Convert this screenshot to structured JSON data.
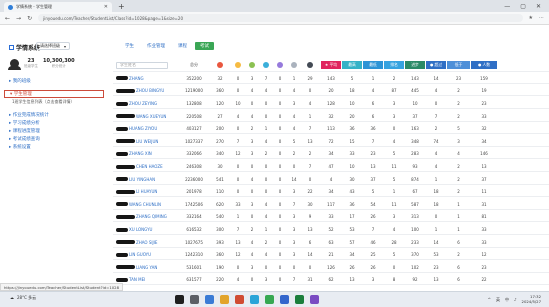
{
  "browser": {
    "tab_title": "学情系统 - 学生管理",
    "new_tab": "+",
    "window_controls": [
      "—",
      "▢",
      "✕"
    ],
    "nav": [
      "←",
      "→",
      "↻"
    ],
    "url": "jinyouedu.com/Teacher/StudentList/Class?id=1028&page=1&size=20",
    "tools": [
      "★",
      "⋯"
    ]
  },
  "app": {
    "logo": "学情系统",
    "class_select": "请选择班级",
    "tabs": [
      {
        "label": "学生",
        "active": false
      },
      {
        "label": "作业管理",
        "active": false
      },
      {
        "label": "课程",
        "active": false
      },
      {
        "label": "考试",
        "active": true
      }
    ]
  },
  "profile": {
    "stat1_num": "23",
    "stat1_label": "班级学生",
    "stat2_num": "10,300,300",
    "stat2_label": "积分统计"
  },
  "menu": [
    {
      "label": "▸ 我的班级",
      "type": "item",
      "active": false
    },
    {
      "label": "▾ 学生管理",
      "type": "item",
      "active": true
    },
    {
      "label": "1班学生信息列表（点击查看详情）",
      "type": "sub",
      "active": false
    },
    {
      "label": "▸ 作业完成情况统计",
      "type": "item",
      "active": false
    },
    {
      "label": "▸ 学习成绩分析",
      "type": "item",
      "active": false
    },
    {
      "label": "▸ 课程进度管理",
      "type": "item",
      "active": false
    },
    {
      "label": "▸ 考试成绩查询",
      "type": "item",
      "active": false
    },
    {
      "label": "▸ 系统设置",
      "type": "item",
      "active": false
    }
  ],
  "table": {
    "search_placeholder": "学生姓名",
    "headers": [
      "学号",
      "总分",
      "",
      "",
      "",
      "",
      "",
      "",
      "",
      "平均",
      "最高",
      "最低",
      "排名",
      "进步",
      "超过",
      "低于"
    ],
    "colored_headers": [
      {
        "label": "★ 平均",
        "color": "#e0245e"
      },
      {
        "label": "最高",
        "color": "#35b2c7"
      },
      {
        "label": "最低",
        "color": "#2c94d6"
      },
      {
        "label": "排名",
        "color": "#36a3e0"
      },
      {
        "label": "进步",
        "color": "#2a8a66"
      },
      {
        "label": "● 超过",
        "color": "#2f6fc5"
      },
      {
        "label": "低于",
        "color": "#4d8fd8"
      },
      {
        "label": "● 人数",
        "color": "#2f6fc5"
      }
    ],
    "dot_colors": [
      "#e9573f",
      "#f6bb42",
      "#8cc152",
      "#3bafda",
      "#967adc",
      "#aab2bd",
      "#434a54"
    ],
    "rows": [
      {
        "name": "ZHANG",
        "id": "352200",
        "score": "32",
        "d": [
          "0",
          "3",
          "7",
          "0",
          "1"
        ],
        "x": [
          "29",
          "143",
          "5",
          "1",
          "2",
          "143",
          "14",
          "23",
          "159"
        ]
      },
      {
        "name": "ZHOU BINGYU",
        "id": "1219000",
        "score": "360",
        "d": [
          "0",
          "4",
          "4",
          "0",
          "4"
        ],
        "x": [
          "0",
          "20",
          "18",
          "4",
          "87",
          "445",
          "4",
          "2",
          "19"
        ]
      },
      {
        "name": "ZHOU ZEYING",
        "id": "132808",
        "score": "120",
        "d": [
          "10",
          "0",
          "0",
          "0",
          "3"
        ],
        "x": [
          "4",
          "128",
          "10",
          "6",
          "3",
          "10",
          "0",
          "2",
          "23"
        ]
      },
      {
        "name": "WANG XUEYUN",
        "id": "220508",
        "score": "27",
        "d": [
          "4",
          "4",
          "0",
          "0",
          "4"
        ],
        "x": [
          "1",
          "32",
          "20",
          "6",
          "3",
          "37",
          "7",
          "2",
          "33"
        ]
      },
      {
        "name": "HUANG ZIYOU",
        "id": "403127",
        "score": "200",
        "d": [
          "0",
          "2",
          "1",
          "0",
          "4"
        ],
        "x": [
          "7",
          "113",
          "36",
          "36",
          "0",
          "163",
          "2",
          "5",
          "32"
        ]
      },
      {
        "name": "LIU WEIJUN",
        "id": "1027337",
        "score": "270",
        "d": [
          "7",
          "3",
          "4",
          "0",
          "5"
        ],
        "x": [
          "13",
          "72",
          "15",
          "7",
          "4",
          "348",
          "74",
          "3",
          "34"
        ]
      },
      {
        "name": "ZHANG XIN",
        "id": "332066",
        "score": "340",
        "d": [
          "12",
          "3",
          "2",
          "0",
          "2"
        ],
        "x": [
          "2",
          "34",
          "33",
          "23",
          "5",
          "283",
          "4",
          "4",
          "146"
        ]
      },
      {
        "name": "CHEN HAOZE",
        "id": "246308",
        "score": "30",
        "d": [
          "0",
          "0",
          "0",
          "0",
          "0"
        ],
        "x": [
          "7",
          "47",
          "10",
          "13",
          "11",
          "93",
          "4",
          "2",
          "13"
        ]
      },
      {
        "name": "LIU YINGHAN",
        "id": "2236000",
        "score": "541",
        "d": [
          "0",
          "4",
          "0",
          "0",
          "14"
        ],
        "x": [
          "0",
          "4",
          "30",
          "37",
          "5",
          "874",
          "1",
          "2",
          "37"
        ]
      },
      {
        "name": "LI HUAYUN",
        "id": "201978",
        "score": "110",
        "d": [
          "0",
          "0",
          "0",
          "0",
          "3"
        ],
        "x": [
          "22",
          "34",
          "43",
          "5",
          "1",
          "67",
          "18",
          "2",
          "11"
        ]
      },
      {
        "name": "WANG CHUNLIN",
        "id": "1742506",
        "score": "620",
        "d": [
          "33",
          "3",
          "4",
          "0",
          "7"
        ],
        "x": [
          "30",
          "117",
          "36",
          "54",
          "11",
          "587",
          "18",
          "1",
          "31"
        ]
      },
      {
        "name": "ZHANG QIMING",
        "id": "332164",
        "score": "540",
        "d": [
          "1",
          "0",
          "4",
          "0",
          "3"
        ],
        "x": [
          "9",
          "33",
          "17",
          "26",
          "3",
          "313",
          "0",
          "1",
          "81"
        ]
      },
      {
        "name": "XU LONGYU",
        "id": "616532",
        "score": "300",
        "d": [
          "7",
          "2",
          "1",
          "0",
          "3"
        ],
        "x": [
          "13",
          "52",
          "53",
          "7",
          "4",
          "100",
          "1",
          "1",
          "33"
        ]
      },
      {
        "name": "ZHAO SIJIE",
        "id": "1027675",
        "score": "393",
        "d": [
          "13",
          "4",
          "2",
          "0",
          "3"
        ],
        "x": [
          "6",
          "63",
          "57",
          "46",
          "28",
          "233",
          "14",
          "6",
          "33"
        ]
      },
      {
        "name": "LIN GUOYU",
        "id": "1242310",
        "score": "360",
        "d": [
          "12",
          "4",
          "4",
          "0",
          "3"
        ],
        "x": [
          "14",
          "21",
          "34",
          "25",
          "5",
          "370",
          "53",
          "2",
          "12"
        ]
      },
      {
        "name": "LIANG YAN",
        "id": "531601",
        "score": "190",
        "d": [
          "0",
          "3",
          "0",
          "0",
          "0"
        ],
        "x": [
          "0",
          "126",
          "26",
          "26",
          "0",
          "102",
          "23",
          "6",
          "23"
        ]
      },
      {
        "name": "TAN MEI",
        "id": "631577",
        "score": "220",
        "d": [
          "4",
          "0",
          "3",
          "0",
          "7"
        ],
        "x": [
          "31",
          "62",
          "13",
          "3",
          "8",
          "92",
          "13",
          "6",
          "22"
        ]
      }
    ]
  },
  "status_url": "https://jinyouedu.com/Teacher/StudentList/Student?id=1028",
  "taskbar": {
    "weather": "28°C 多云",
    "tray": [
      "^",
      "英",
      "中",
      "♪"
    ],
    "time": "17:32",
    "date": "2024/5/27"
  }
}
